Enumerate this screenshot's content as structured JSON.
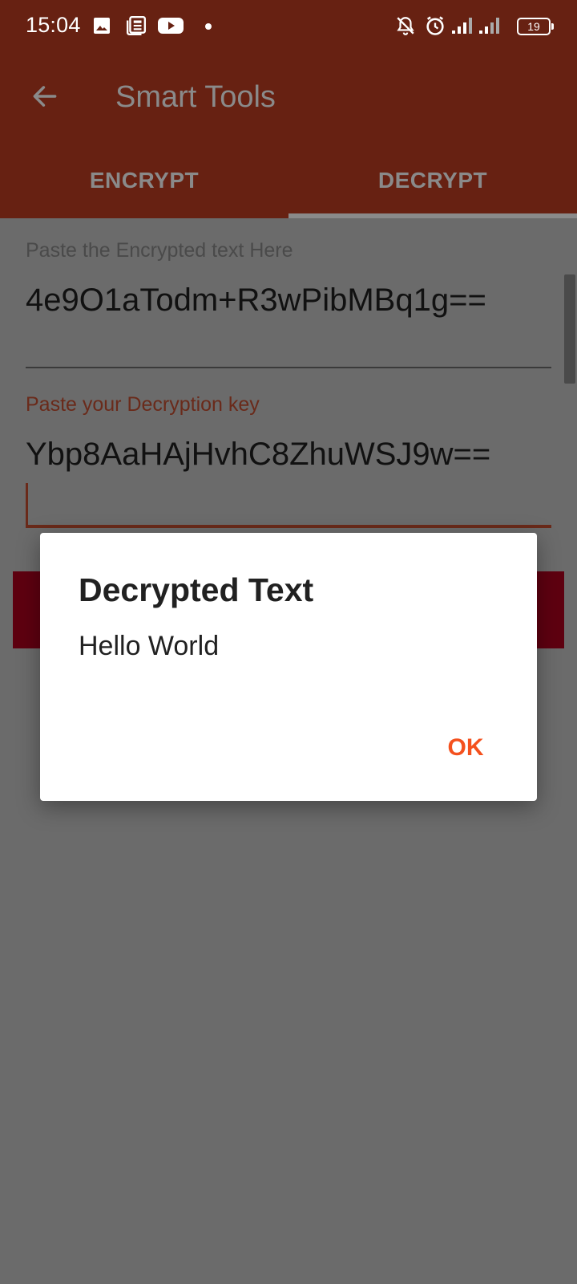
{
  "status_bar": {
    "time": "15:04",
    "battery": "19",
    "icons": [
      "image-icon",
      "news-icon",
      "youtube-icon",
      "dot-icon",
      "bell-off-icon",
      "alarm-icon",
      "signal-icon",
      "signal-icon",
      "battery-icon"
    ]
  },
  "appbar": {
    "title": "Smart Tools",
    "back_icon": "arrow-left-icon"
  },
  "tabs": [
    {
      "label": "ENCRYPT"
    },
    {
      "label": "DECRYPT"
    }
  ],
  "tabs_selected": "DECRYPT",
  "form": {
    "encrypted_label": "Paste the Encrypted text Here",
    "encrypted_value": "4e9O1aTodm+R3wPibMBq1g==",
    "key_label": "Paste your Decryption key",
    "key_value": "Ybp8AaHAjHvhC8ZhuWSJ9w=="
  },
  "dialog": {
    "title": "Decrypted Text",
    "message": "Hello World",
    "ok_label": "OK"
  },
  "colors": {
    "primary_dark": "#672112",
    "accent": "#f4511e",
    "button": "#5e0010",
    "scrim": "#6b6b6b"
  }
}
